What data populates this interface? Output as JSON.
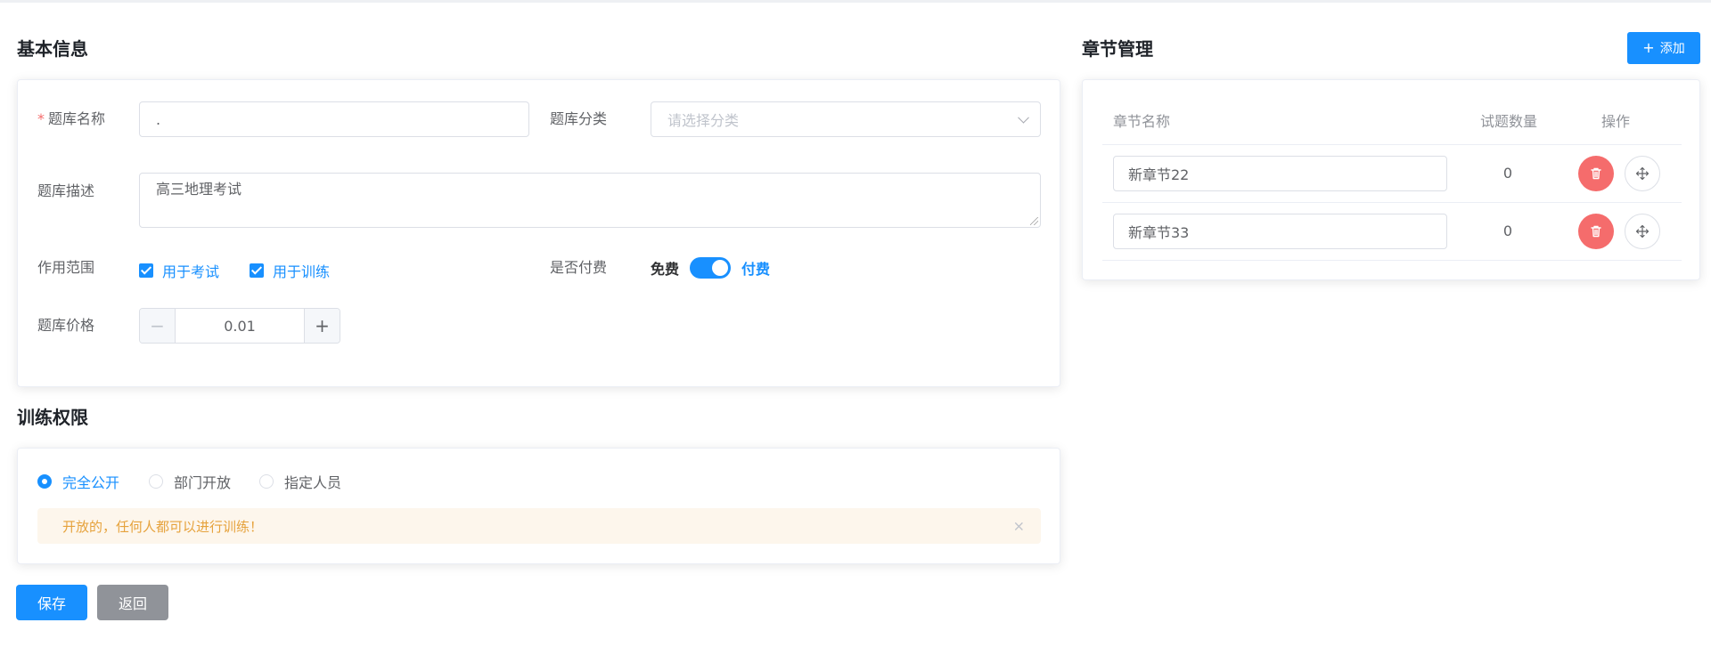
{
  "basic_info": {
    "title": "基本信息",
    "name_label": "题库名称",
    "name_value": ".",
    "category_label": "题库分类",
    "category_placeholder": "请选择分类",
    "desc_label": "题库描述",
    "desc_value": "高三地理考试",
    "scope_label": "作用范围",
    "scope_options": [
      {
        "label": "用于考试",
        "checked": true
      },
      {
        "label": "用于训练",
        "checked": true
      }
    ],
    "paid_label": "是否付费",
    "paid_off_text": "免费",
    "paid_on_text": "付费",
    "paid_enabled": true,
    "price_label": "题库价格",
    "price_value": "0.01",
    "minus_symbol": "−",
    "plus_symbol": "+"
  },
  "training": {
    "title": "训练权限",
    "options": [
      {
        "label": "完全公开",
        "checked": true
      },
      {
        "label": "部门开放",
        "checked": false
      },
      {
        "label": "指定人员",
        "checked": false
      }
    ],
    "alert_text": "开放的，任何人都可以进行训练！",
    "alert_close": "×"
  },
  "actions": {
    "save_label": "保存",
    "back_label": "返回"
  },
  "chapters": {
    "title": "章节管理",
    "add_label": "添加",
    "add_symbol": "+",
    "columns": [
      "章节名称",
      "试题数量",
      "操作"
    ],
    "rows": [
      {
        "name": "新章节22",
        "count": "0"
      },
      {
        "name": "新章节33",
        "count": "0"
      }
    ]
  },
  "colors": {
    "primary": "#1890ff",
    "danger": "#f56c6c",
    "warning_bg": "#fdf6ec",
    "warning_text": "#e6a23c"
  }
}
